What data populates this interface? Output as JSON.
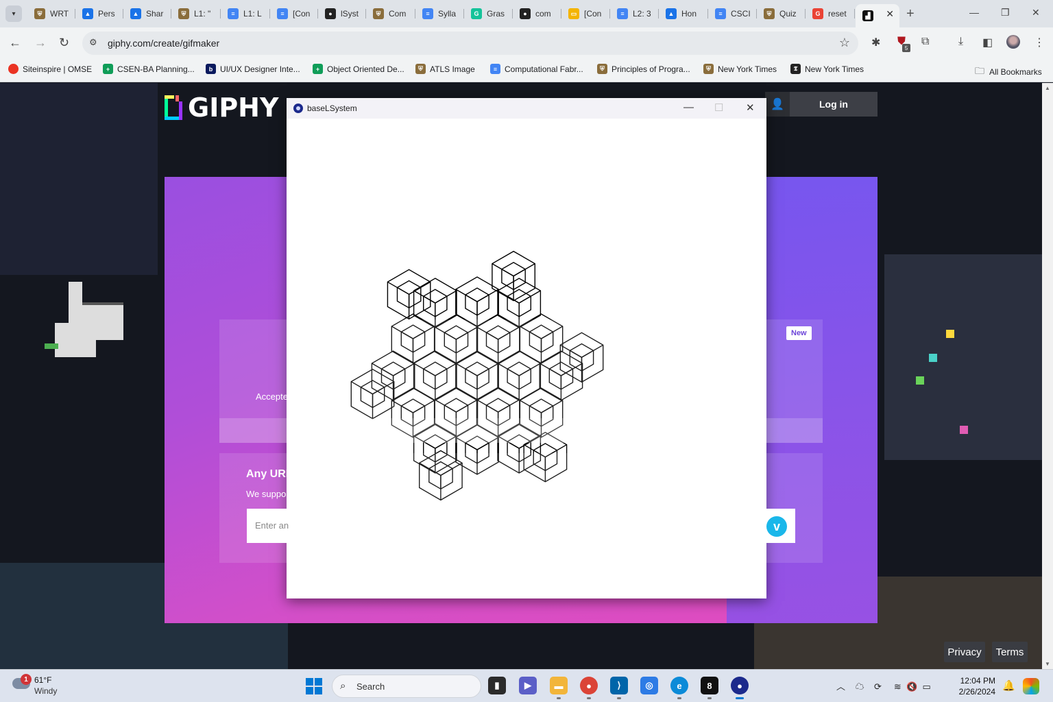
{
  "browser": {
    "tabs": [
      {
        "label": "WRT",
        "color": "#8a6d3b",
        "glyph": "⛨"
      },
      {
        "label": "Pers",
        "color": "#1a73e8",
        "glyph": "▲"
      },
      {
        "label": "Shar",
        "color": "#1a73e8",
        "glyph": "▲"
      },
      {
        "label": "L1: \"",
        "color": "#8a6d3b",
        "glyph": "⛨"
      },
      {
        "label": "L1: L",
        "color": "#4285f4",
        "glyph": "≡"
      },
      {
        "label": "[Con",
        "color": "#4285f4",
        "glyph": "≡"
      },
      {
        "label": "lSyst",
        "color": "#222222",
        "glyph": "●"
      },
      {
        "label": "Com",
        "color": "#8a6d3b",
        "glyph": "⛨"
      },
      {
        "label": "Sylla",
        "color": "#4285f4",
        "glyph": "≡"
      },
      {
        "label": "Gras",
        "color": "#15c39a",
        "glyph": "G"
      },
      {
        "label": "com",
        "color": "#222222",
        "glyph": "●"
      },
      {
        "label": "[Con",
        "color": "#f4b400",
        "glyph": "▭"
      },
      {
        "label": "L2: 3",
        "color": "#4285f4",
        "glyph": "≡"
      },
      {
        "label": "Hon",
        "color": "#1a73e8",
        "glyph": "▲"
      },
      {
        "label": "CSCI",
        "color": "#4285f4",
        "glyph": "≡"
      },
      {
        "label": "Quiz",
        "color": "#8a6d3b",
        "glyph": "⛨"
      },
      {
        "label": "reset",
        "color": "#ea4335",
        "glyph": "G"
      }
    ],
    "active_tab": {
      "label": "",
      "color": "#111111"
    },
    "new_tab_label": "+",
    "url": "giphy.com/create/gifmaker",
    "bookmarks": [
      {
        "label": "Siteinspire | OMSE",
        "color": "#ea3323",
        "glyph": ""
      },
      {
        "label": "CSEN-BA Planning...",
        "color": "#0f9d58",
        "glyph": "+"
      },
      {
        "label": "UI/UX Designer Inte...",
        "color": "#0a1a5e",
        "glyph": "b"
      },
      {
        "label": "Object Oriented De...",
        "color": "#0f9d58",
        "glyph": "+"
      },
      {
        "label": "ATLS Image",
        "color": "#8a6d3b",
        "glyph": "⛨"
      },
      {
        "label": "Computational Fabr...",
        "color": "#4285f4",
        "glyph": "≡"
      },
      {
        "label": "Principles of Progra...",
        "color": "#8a6d3b",
        "glyph": "⛨"
      },
      {
        "label": "New York Times",
        "color": "#8a6d3b",
        "glyph": "⛨"
      },
      {
        "label": "New York Times",
        "color": "#222222",
        "glyph": "𝕿"
      }
    ],
    "all_bookmarks": "All Bookmarks",
    "extension_badge": "5"
  },
  "giphy": {
    "logo_text": "GIPHY",
    "login_label": "Log in",
    "upload_hint": "Accepte",
    "new_badge": "New",
    "url_title": "Any URL",
    "url_sub": "We suppo",
    "url_placeholder": "Enter an",
    "vimeo_glyph": "v",
    "privacy": "Privacy",
    "terms": "Terms"
  },
  "app_window": {
    "title": "baseLSystem",
    "minimize": "—",
    "maximize": "☐",
    "close": "✕",
    "stroke_color": "#000000"
  },
  "taskbar": {
    "weather_alert": "1",
    "temperature": "61°F",
    "condition": "Windy",
    "search_label": "Search",
    "time": "12:04 PM",
    "date": "2/26/2024",
    "apps": [
      {
        "name": "file-explorer",
        "color": "#2b2b2b",
        "glyph": "▮"
      },
      {
        "name": "teams",
        "color": "#5b5fc7",
        "glyph": "▶"
      },
      {
        "name": "files",
        "color": "#f2b53a",
        "glyph": "▬"
      },
      {
        "name": "chrome",
        "color": "#db4437",
        "glyph": "●"
      },
      {
        "name": "vscode",
        "color": "#0065a9",
        "glyph": "⟩"
      },
      {
        "name": "app",
        "color": "#2d7be5",
        "glyph": "◎"
      },
      {
        "name": "edge",
        "color": "#0c8bd8",
        "glyph": "e"
      },
      {
        "name": "dev-app",
        "color": "#111111",
        "glyph": "8"
      },
      {
        "name": "processing",
        "color": "#1c2a8c",
        "glyph": "●"
      }
    ]
  }
}
